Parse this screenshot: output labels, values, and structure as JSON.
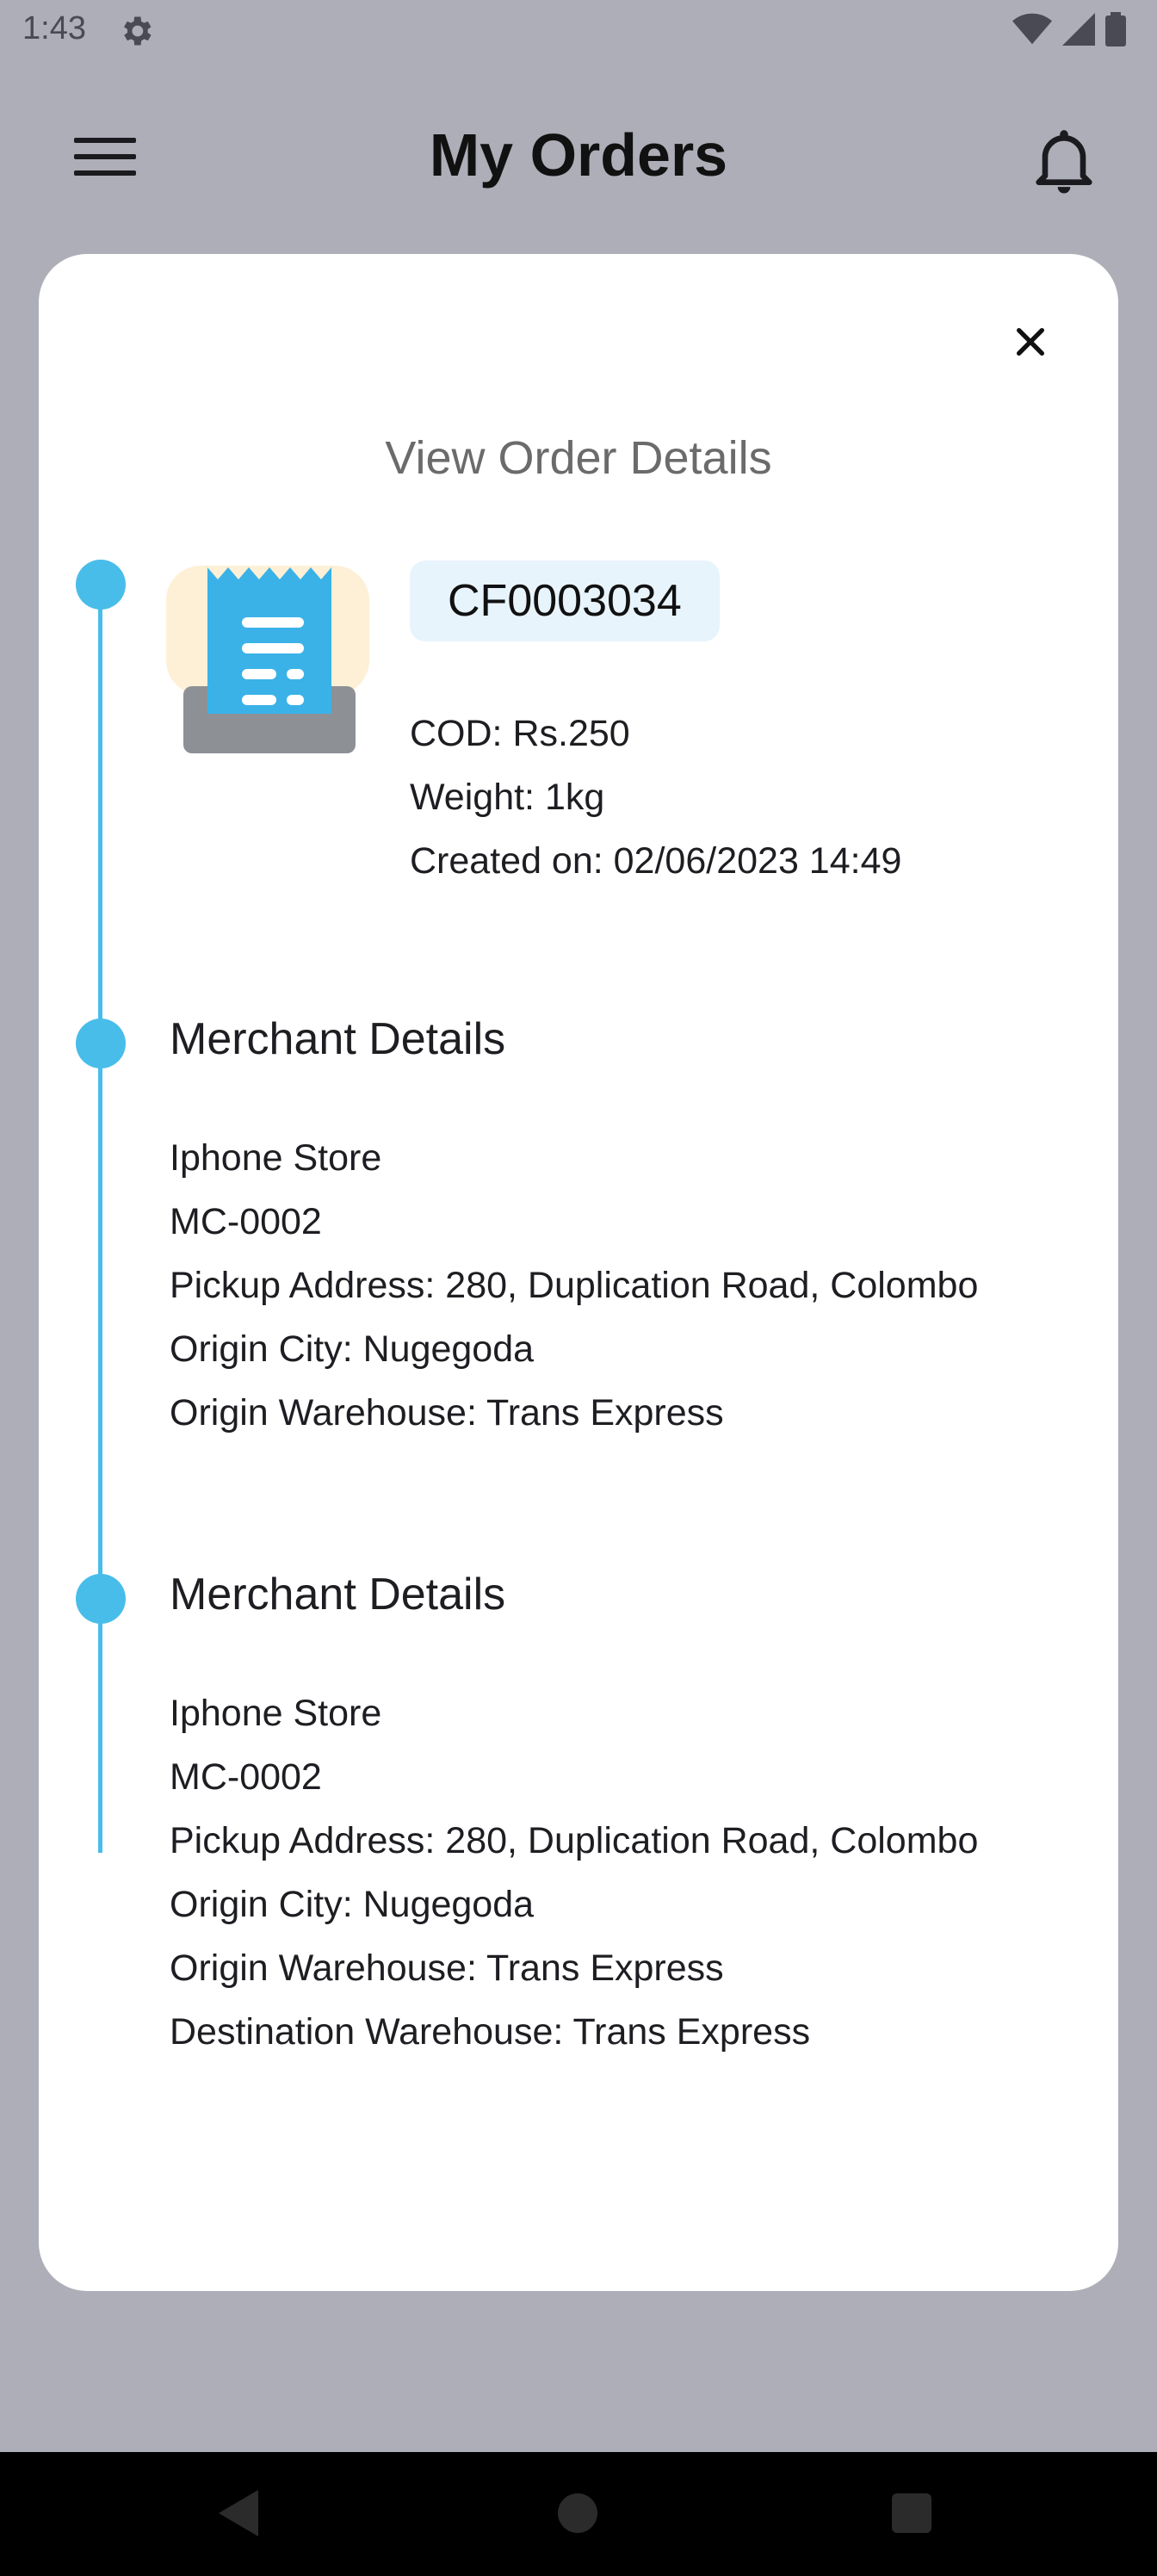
{
  "status_bar": {
    "time": "1:43",
    "icons": [
      "settings-gear-icon",
      "wifi-icon",
      "signal-icon",
      "battery-icon"
    ]
  },
  "app_bar": {
    "title": "My Orders",
    "menu_icon": "hamburger-menu-icon",
    "notification_icon": "bell-icon"
  },
  "modal": {
    "title": "View Order Details",
    "close_icon": "close-icon",
    "order": {
      "id": "CF0003034",
      "icon": "receipt-icon",
      "cod": "COD: Rs.250",
      "weight": "Weight: 1kg",
      "created_on": "Created on: 02/06/2023 14:49"
    },
    "sections": [
      {
        "title": "Merchant Details",
        "lines": [
          "Iphone Store",
          "MC-0002",
          "Pickup Address: 280, Duplication Road, Colombo",
          "Origin City: Nugegoda",
          "Origin Warehouse: Trans Express"
        ]
      },
      {
        "title": "Merchant Details",
        "lines": [
          "Iphone Store",
          "MC-0002",
          "Pickup Address: 280, Duplication Road, Colombo",
          "Origin City: Nugegoda",
          "Origin Warehouse: Trans Express",
          "Destination Warehouse: Trans Express"
        ]
      }
    ]
  },
  "nav_bar": {
    "icons": [
      "back-icon",
      "home-icon",
      "recents-icon"
    ]
  },
  "colors": {
    "accent": "#49bde9",
    "chip_bg": "#e8f4fc",
    "scrim": "#adaeb8"
  }
}
